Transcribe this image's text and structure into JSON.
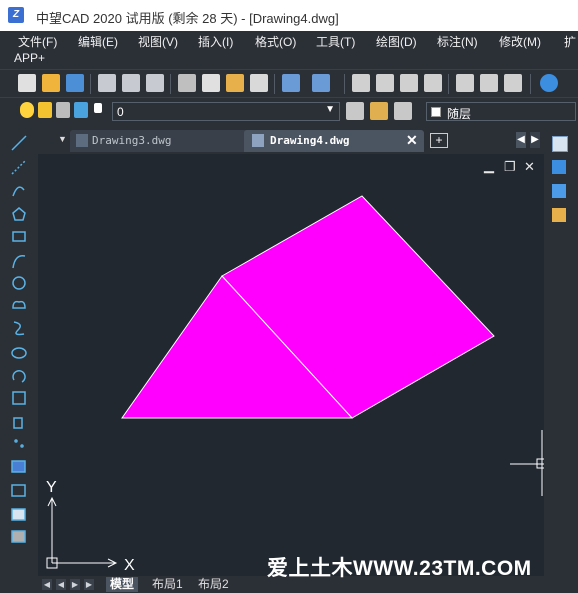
{
  "window": {
    "title": "中望CAD 2020 试用版 (剩余 28 天) - [Drawing4.dwg]",
    "logo_letter": "Z"
  },
  "menu": {
    "items": [
      "文件(F)",
      "编辑(E)",
      "视图(V)",
      "插入(I)",
      "格式(O)",
      "工具(T)",
      "绘图(D)",
      "标注(N)",
      "修改(M)",
      "扩"
    ],
    "second_row": "APP+"
  },
  "layer": {
    "current_layer": "0",
    "color_value": "随层"
  },
  "tabs": [
    {
      "label": "Drawing3.dwg",
      "active": false
    },
    {
      "label": "Drawing4.dwg",
      "active": true
    }
  ],
  "drawing": {
    "fill_color": "#ff00ff",
    "edge_color": "#ffffff",
    "background": "#212830"
  },
  "ucs": {
    "x_label": "X",
    "y_label": "Y"
  },
  "layout_tabs": [
    "模型",
    "布局1",
    "布局2"
  ],
  "watermark": "爱上土木WWW.23TM.COM",
  "colors": {
    "ui_dark": "#2b2f36",
    "canvas": "#212830",
    "accent_blue": "#3b6fd1"
  }
}
